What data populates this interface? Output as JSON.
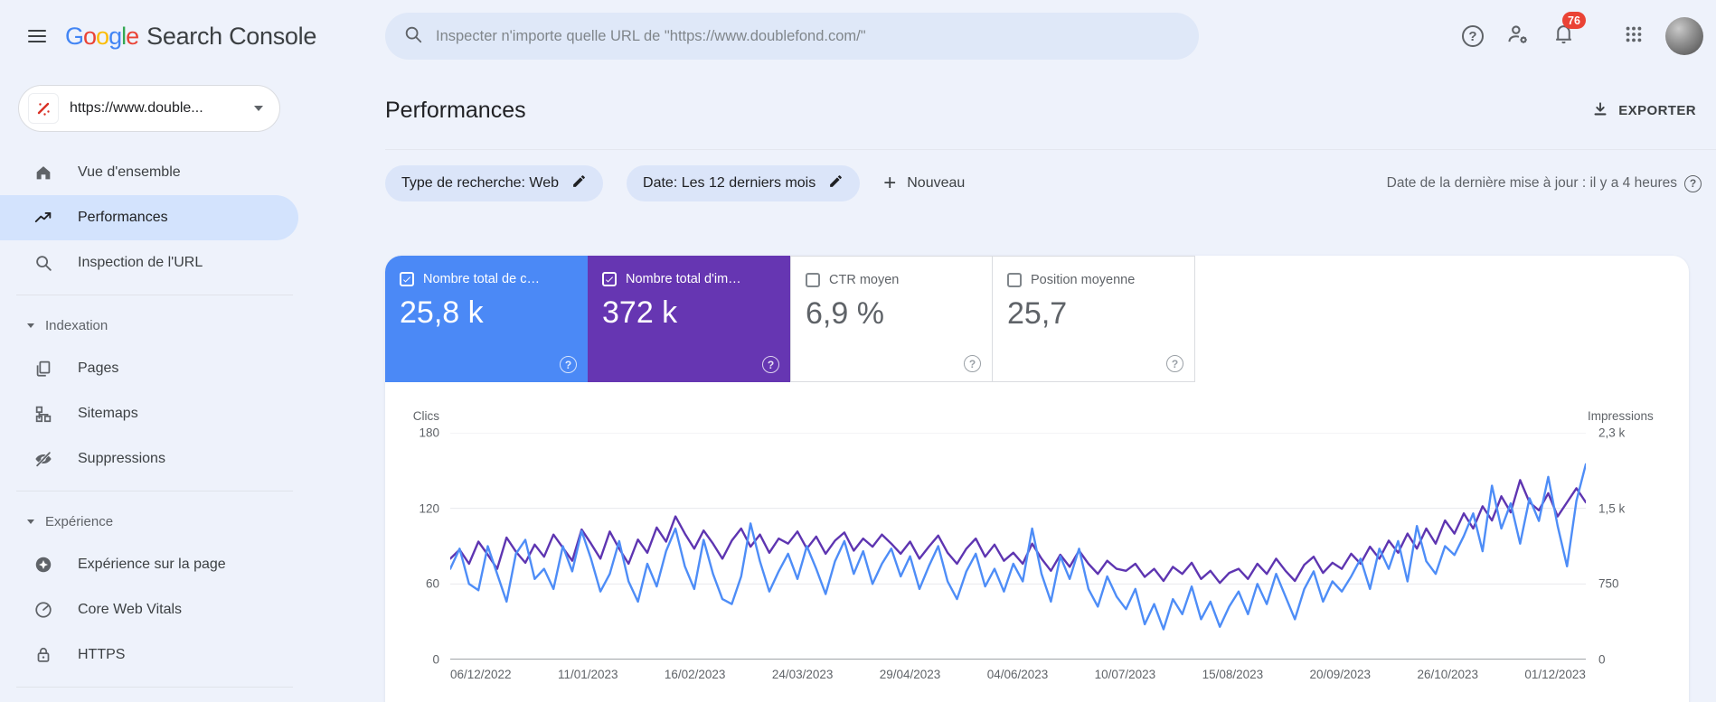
{
  "header": {
    "logo": {
      "letters": [
        {
          "ch": "G",
          "color": "#4285F4"
        },
        {
          "ch": "o",
          "color": "#EA4335"
        },
        {
          "ch": "o",
          "color": "#FBBC05"
        },
        {
          "ch": "g",
          "color": "#4285F4"
        },
        {
          "ch": "l",
          "color": "#34A853"
        },
        {
          "ch": "e",
          "color": "#EA4335"
        }
      ],
      "product": "Search Console"
    },
    "search": {
      "placeholder": "Inspecter n'importe quelle URL de \"https://www.doublefond.com/\""
    },
    "notifications": {
      "badge_count": "76",
      "badge_color": "#EA4335"
    }
  },
  "sidebar": {
    "property_selector": {
      "label": "https://www.double..."
    },
    "items": [
      {
        "label": "Vue d'ensemble",
        "selected": false
      },
      {
        "label": "Performances",
        "selected": true
      },
      {
        "label": "Inspection de l'URL",
        "selected": false
      },
      {
        "label": "Pages",
        "selected": false
      },
      {
        "label": "Sitemaps",
        "selected": false
      },
      {
        "label": "Suppressions",
        "selected": false
      },
      {
        "label": "Expérience sur la page",
        "selected": false
      },
      {
        "label": "Core Web Vitals",
        "selected": false
      },
      {
        "label": "HTTPS",
        "selected": false
      }
    ],
    "sections": [
      {
        "label": "Indexation"
      },
      {
        "label": "Expérience"
      }
    ],
    "selected_bg": "#d3e3fd"
  },
  "page": {
    "title": "Performances",
    "export_label": "EXPORTER",
    "filters": {
      "chips": [
        {
          "label": "Type de recherche: Web"
        },
        {
          "label": "Date: Les 12 derniers mois"
        }
      ],
      "new_button_label": "Nouveau",
      "last_update": "Date de la dernière mise à jour : il y a 4 heures"
    }
  },
  "metrics": {
    "cards": [
      {
        "label": "Nombre total de c…",
        "value": "25,8 k",
        "checked": true,
        "bg": "#4b89f6",
        "text": "#ffffff"
      },
      {
        "label": "Nombre total d'im…",
        "value": "372 k",
        "checked": true,
        "bg": "#6636b2",
        "text": "#ffffff"
      },
      {
        "label": "CTR moyen",
        "value": "6,9 %",
        "checked": false,
        "bg": "#ffffff",
        "text": "#5f6368"
      },
      {
        "label": "Position moyenne",
        "value": "25,7",
        "checked": false,
        "bg": "#ffffff",
        "text": "#5f6368"
      }
    ]
  },
  "chart_data": {
    "type": "line",
    "x_labels": [
      "06/12/2022",
      "11/01/2023",
      "16/02/2023",
      "24/03/2023",
      "29/04/2023",
      "04/06/2023",
      "10/07/2023",
      "15/08/2023",
      "20/09/2023",
      "26/10/2023",
      "01/12/2023"
    ],
    "left_axis": {
      "title": "Clics",
      "max": 180,
      "ticks": [
        {
          "label": "180",
          "value": 180
        },
        {
          "label": "120",
          "value": 120
        },
        {
          "label": "60",
          "value": 60
        },
        {
          "label": "0",
          "value": 0
        }
      ]
    },
    "right_axis": {
      "title": "Impressions",
      "max": 2250,
      "ticks": [
        {
          "label": "2,3 k",
          "value": 2250
        },
        {
          "label": "1,5 k",
          "value": 1500
        },
        {
          "label": "750",
          "value": 750
        },
        {
          "label": "0",
          "value": 0
        }
      ]
    },
    "grid_color": "#e8eaed",
    "baseline_color": "#80868b",
    "legend_position": "none",
    "series": [
      {
        "name": "Impressions",
        "axis": "right",
        "color": "#5e35b1",
        "values": [
          1000,
          1090,
          950,
          1170,
          1040,
          900,
          1210,
          1070,
          960,
          1140,
          1020,
          1240,
          1110,
          980,
          1290,
          1150,
          1000,
          1270,
          1100,
          950,
          1190,
          1060,
          1310,
          1170,
          1420,
          1250,
          1100,
          1280,
          1150,
          1000,
          1180,
          1300,
          1120,
          1240,
          1060,
          1200,
          1150,
          1270,
          1100,
          1220,
          1050,
          1180,
          1260,
          1080,
          1200,
          1120,
          1240,
          1150,
          1050,
          1170,
          1000,
          1120,
          1230,
          1060,
          950,
          1100,
          1200,
          1020,
          1140,
          980,
          1060,
          950,
          1150,
          1000,
          880,
          1040,
          920,
          1080,
          950,
          850,
          980,
          900,
          880,
          950,
          820,
          900,
          780,
          920,
          850,
          960,
          800,
          880,
          760,
          860,
          900,
          800,
          950,
          850,
          1000,
          880,
          780,
          940,
          1020,
          860,
          960,
          900,
          1050,
          950,
          1120,
          1000,
          1180,
          1060,
          1250,
          1100,
          1300,
          1150,
          1380,
          1250,
          1450,
          1300,
          1520,
          1380,
          1620,
          1460,
          1780,
          1560,
          1480,
          1650,
          1420,
          1560,
          1700,
          1560
        ]
      },
      {
        "name": "Clics",
        "axis": "left",
        "color": "#4e8df7",
        "values": [
          72,
          88,
          60,
          55,
          90,
          68,
          46,
          84,
          95,
          64,
          72,
          56,
          90,
          70,
          102,
          80,
          54,
          68,
          94,
          62,
          46,
          76,
          58,
          86,
          104,
          74,
          56,
          95,
          68,
          48,
          44,
          66,
          108,
          78,
          54,
          70,
          84,
          64,
          90,
          72,
          52,
          78,
          94,
          68,
          86,
          60,
          76,
          88,
          66,
          82,
          56,
          74,
          90,
          62,
          48,
          70,
          84,
          58,
          72,
          54,
          76,
          62,
          104,
          68,
          46,
          82,
          64,
          88,
          56,
          42,
          66,
          50,
          40,
          56,
          28,
          44,
          24,
          48,
          36,
          58,
          32,
          46,
          26,
          42,
          54,
          36,
          60,
          44,
          68,
          50,
          32,
          56,
          70,
          46,
          62,
          54,
          66,
          80,
          56,
          88,
          72,
          94,
          62,
          106,
          78,
          68,
          90,
          83,
          98,
          116,
          86,
          138,
          104,
          124,
          92,
          128,
          110,
          145,
          106,
          74,
          126,
          155
        ]
      }
    ]
  }
}
